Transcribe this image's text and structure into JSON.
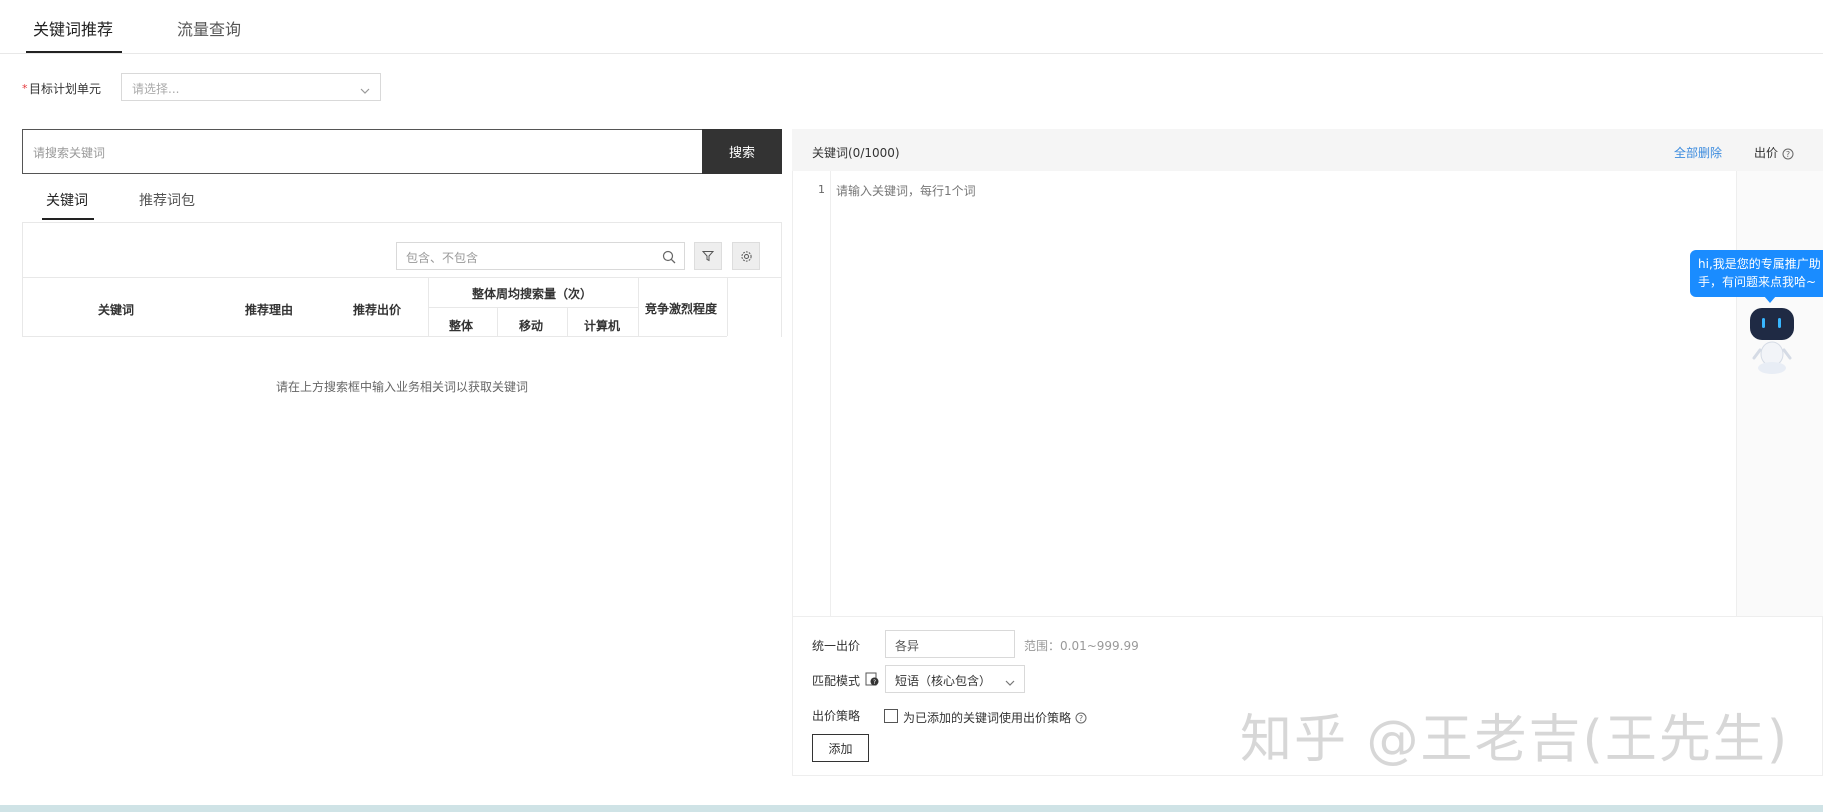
{
  "top_tabs": [
    {
      "label": "关键词推荐",
      "active": true
    },
    {
      "label": "流量查询",
      "active": false
    }
  ],
  "target": {
    "required_mark": "*",
    "label": "目标计划单元",
    "placeholder": "请选择..."
  },
  "search": {
    "placeholder": "请搜索关键词",
    "button": "搜索"
  },
  "sub_tabs": [
    {
      "label": "关键词",
      "active": true
    },
    {
      "label": "推荐词包",
      "active": false
    }
  ],
  "filter": {
    "placeholder": "包含、不包含"
  },
  "table": {
    "headers": {
      "keyword": "关键词",
      "reason": "推荐理由",
      "bid": "推荐出价",
      "weekly_search": "整体周均搜索量（次）",
      "overall": "整体",
      "mobile": "移动",
      "computer": "计算机",
      "competition": "竞争激烈程度"
    },
    "empty_message": "请在上方搜索框中输入业务相关词以获取关键词"
  },
  "right_panel": {
    "title": "关键词(0/1000)",
    "delete_all": "全部删除",
    "bid_label": "出价",
    "line_number": "1",
    "editor_placeholder": "请输入关键词，每行1个词",
    "assistant_bubble_line1": "hi,我是您的专属推广助",
    "assistant_bubble_line2": "手，有问题来点我哈~"
  },
  "form": {
    "unified_bid_label": "统一出价",
    "unified_bid_value": "各异",
    "range": "范围：0.01~999.99",
    "match_label": "匹配模式",
    "match_value": "短语（核心包含）",
    "strategy_label": "出价策略",
    "strategy_checkbox_text": "为已添加的关键词使用出价策略",
    "add_button": "添加"
  },
  "watermark": "知乎 @王老吉(王先生)",
  "colors": {
    "accent_link": "#3b8bde",
    "search_button": "#333333",
    "assistant_bubble": "#1a8cff",
    "required": "#e4393c"
  }
}
